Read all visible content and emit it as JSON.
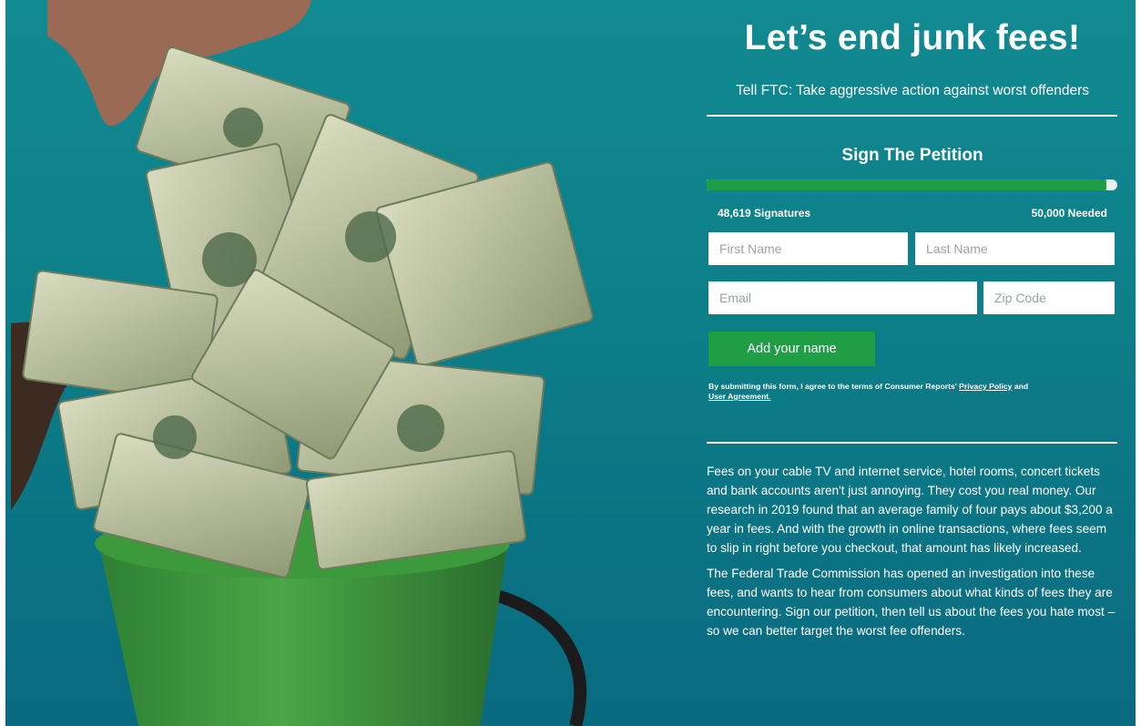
{
  "headline": "Let’s end junk fees!",
  "subheadline": "Tell FTC: Take aggressive action against worst offenders",
  "petition": {
    "title": "Sign The Petition",
    "progress_fraction": 0.9724,
    "signatures_label": "48,619 Signatures",
    "needed_label": "50,000 Needed"
  },
  "form": {
    "first_name_placeholder": "First Name",
    "last_name_placeholder": "Last Name",
    "email_placeholder": "Email",
    "zip_placeholder": "Zip Code",
    "submit_label": "Add your name",
    "disclaimer_prefix": "By submitting this form, I agree to the terms of Consumer Reports' ",
    "privacy_link": "Privacy Policy",
    "disclaimer_and": " and ",
    "agreement_link": "User Agreement."
  },
  "body": {
    "paragraph1": "Fees on your cable TV and internet service, hotel rooms, concert tickets and bank accounts aren't just annoying. They cost you real money. Our research in 2019 found that an average family of four pays about $3,200 a year in fees. And with the growth in online transactions, where fees seem to slip in right before you checkout, that amount has likely increased.",
    "paragraph2": "The Federal Trade Commission has opened an investigation into these fees, and wants to hear from consumers about what kinds of fees they are encountering. Sign our petition, then tell us about the fees you hate most – so we can better target the worst fee offenders."
  },
  "colors": {
    "background": "#0c7e88",
    "accent_green": "#1f9e46",
    "text": "#ffffff"
  }
}
